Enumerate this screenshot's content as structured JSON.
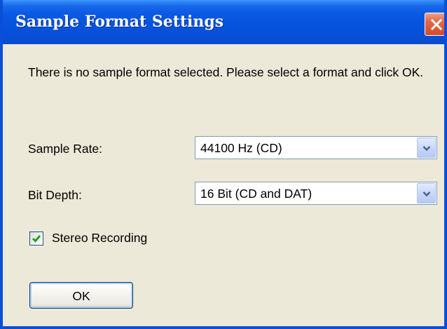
{
  "window": {
    "title": "Sample Format Settings"
  },
  "message": "There is no sample format selected.  Please select a format and click OK.",
  "sample_rate": {
    "label": "Sample Rate:",
    "value": "44100 Hz (CD)"
  },
  "bit_depth": {
    "label": "Bit Depth:",
    "value": "16 Bit (CD and DAT)"
  },
  "stereo": {
    "label": "Stereo Recording",
    "checked": true
  },
  "ok_button": {
    "label": "OK"
  },
  "icons": {
    "close": "close-icon",
    "dropdown": "chevron-down-icon",
    "check": "checkmark-icon"
  },
  "colors": {
    "titlebar": "#0653de",
    "close_button": "#e46a4b",
    "dialog_background": "#ece9d8",
    "checkmark": "#21a121"
  }
}
